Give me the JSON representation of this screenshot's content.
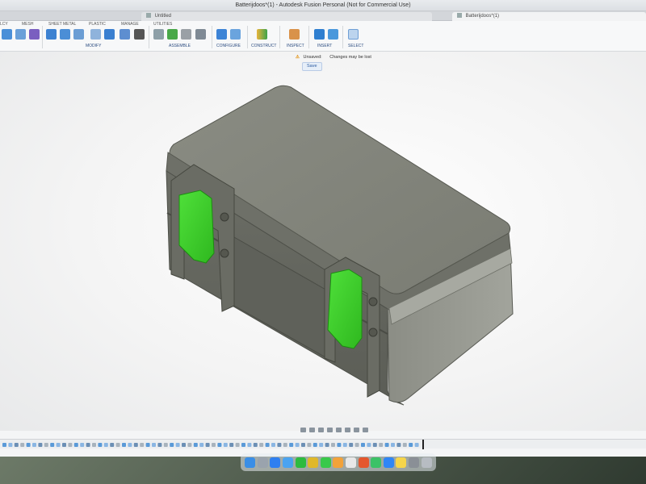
{
  "window": {
    "title": "Batterijdoos*(1) - Autodesk Fusion Personal (Not for Commercial Use)"
  },
  "tabs": [
    {
      "label": "Untitled"
    },
    {
      "label": "Batterijdoos*(1)"
    }
  ],
  "ribbon": {
    "workspace_tabs": [
      "LCY",
      "MESH",
      "SHEET METAL",
      "PLASTIC",
      "MANAGE",
      "UTILITIES"
    ],
    "groups": [
      "MODIFY",
      "ASSEMBLE",
      "CONFIGURE",
      "CONSTRUCT",
      "INSPECT",
      "INSERT",
      "SELECT"
    ]
  },
  "status": {
    "unsaved_label": "Unsaved:",
    "message": "Changes may be lost",
    "save_label": "Save"
  },
  "model": {
    "name": "Battery box",
    "body_color": "#7b7d74",
    "latch_color": "#3fd62a"
  },
  "colors": {
    "accent": "#2c4c80",
    "warning": "#e08a00",
    "viewport_bg": "#f4f4f4"
  },
  "dock": {
    "icons": [
      "finder-icon",
      "launchpad-icon",
      "safari-icon",
      "mail-icon",
      "whatsapp-icon",
      "chrome-icon",
      "messages-icon",
      "photos-icon",
      "calendar-icon",
      "fusion-icon",
      "facetime-icon",
      "appstore-icon",
      "notes-icon",
      "settings-icon",
      "trash-icon"
    ]
  }
}
